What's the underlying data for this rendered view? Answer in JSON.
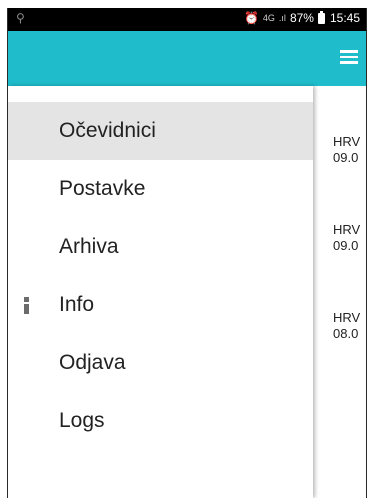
{
  "status_bar": {
    "left_icon": "cast-icon",
    "alarm_icon": "⏰",
    "network": "4G",
    "signal": ".ıl",
    "battery": "87%",
    "time": "15:45"
  },
  "app_bar": {
    "menu_icon": "hamburger-icon",
    "background_color": "#1fbccb"
  },
  "drawer": {
    "items": [
      {
        "label": "Očevidnici",
        "active": true
      },
      {
        "label": "Postavke",
        "active": false
      },
      {
        "label": "Arhiva",
        "active": false
      },
      {
        "label": "Info",
        "active": false,
        "icon": "info-icon"
      },
      {
        "label": "Odjava",
        "active": false
      },
      {
        "label": "Logs",
        "active": false
      }
    ]
  },
  "background_list": {
    "items": [
      {
        "line1": "HRV",
        "line2": "09.0"
      },
      {
        "line1": "HRV",
        "line2": "09.0"
      },
      {
        "line1": "HRV",
        "line2": "08.0"
      }
    ]
  }
}
